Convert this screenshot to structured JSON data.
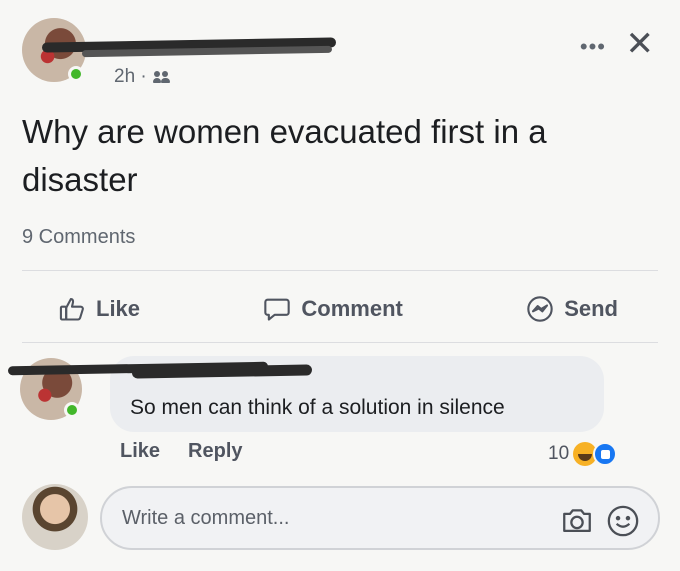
{
  "post": {
    "time": "2h ·",
    "text": "Why are women evacuated first in a disaster",
    "comment_count": "9 Comments"
  },
  "actions": {
    "like_label": "Like",
    "comment_label": "Comment",
    "send_label": "Send"
  },
  "comment": {
    "text": "So men can think of a solution in silence",
    "like_label": "Like",
    "reply_label": "Reply",
    "reaction_count": "10"
  },
  "composer": {
    "placeholder": "Write a comment..."
  },
  "icons": {
    "more": "more-options-icon",
    "close": "close-icon",
    "audience": "friends-audience-icon",
    "like": "thumbs-up-icon",
    "comment": "speech-bubble-icon",
    "send": "messenger-icon",
    "camera": "camera-icon",
    "emoji": "smiley-icon"
  },
  "colors": {
    "online": "#42b72a",
    "haha": "#f7b125",
    "like_blue": "#1877f2"
  }
}
